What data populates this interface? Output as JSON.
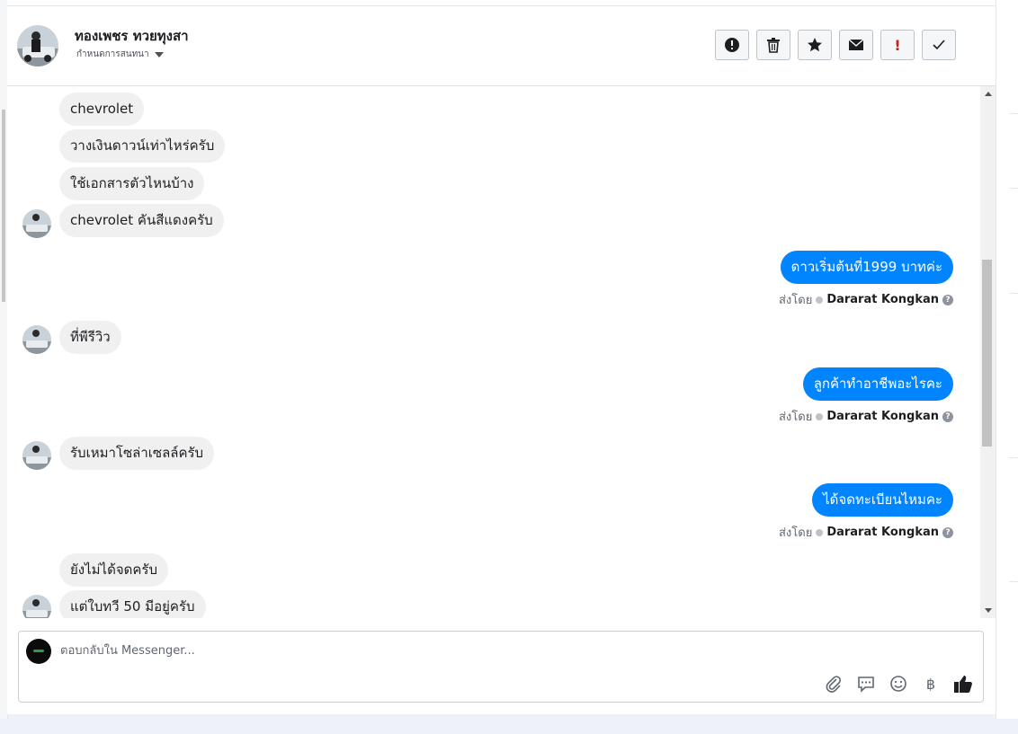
{
  "header": {
    "contact_name": "ทองเพชร ทวยทุงสา",
    "conversation_settings": "กำหนดการสนทนา"
  },
  "actions": [
    {
      "name": "mark-spam-button",
      "icon": "exclamation-circle-icon"
    },
    {
      "name": "delete-button",
      "icon": "trash-icon"
    },
    {
      "name": "star-button",
      "icon": "star-icon"
    },
    {
      "name": "mark-unread-button",
      "icon": "envelope-icon"
    },
    {
      "name": "important-button",
      "icon": "exclamation-icon",
      "label": "!"
    },
    {
      "name": "mark-done-button",
      "icon": "check-icon"
    }
  ],
  "messages": [
    {
      "from": "customer",
      "text": "chevrolet"
    },
    {
      "from": "customer",
      "text": "วางเงินดาวน์เท่าไหร่ครับ"
    },
    {
      "from": "customer",
      "text": "ใช้เอกสารตัวไหนบ้าง"
    },
    {
      "from": "customer",
      "text": "chevrolet คันสีแดงครับ"
    },
    {
      "from": "page",
      "text": "ดาวเริ่มต้นที่1999 บาทค่ะ",
      "sent_by_label": "ส่งโดย",
      "agent": "Dararat Kongkan"
    },
    {
      "from": "customer",
      "text": "ที่พีรีวิว"
    },
    {
      "from": "page",
      "text": "ลูกค้าทำอาชีพอะไรคะ",
      "sent_by_label": "ส่งโดย",
      "agent": "Dararat Kongkan"
    },
    {
      "from": "customer",
      "text": "รับเหมาโซล่าเซลล์ครับ"
    },
    {
      "from": "page",
      "text": "ได้จดทะเบียนไหมคะ",
      "sent_by_label": "ส่งโดย",
      "agent": "Dararat Kongkan"
    },
    {
      "from": "customer",
      "text": "ยังไม่ได้จดครับ"
    },
    {
      "from": "customer",
      "text": "แต่ใบทวี 50 มีอยู่ครับ"
    }
  ],
  "composer": {
    "placeholder": "ตอบกลับใน Messenger...",
    "baht_symbol": "฿"
  },
  "colors": {
    "outgoing_bubble": "#0084ff",
    "incoming_bubble": "#f0f0f0"
  }
}
